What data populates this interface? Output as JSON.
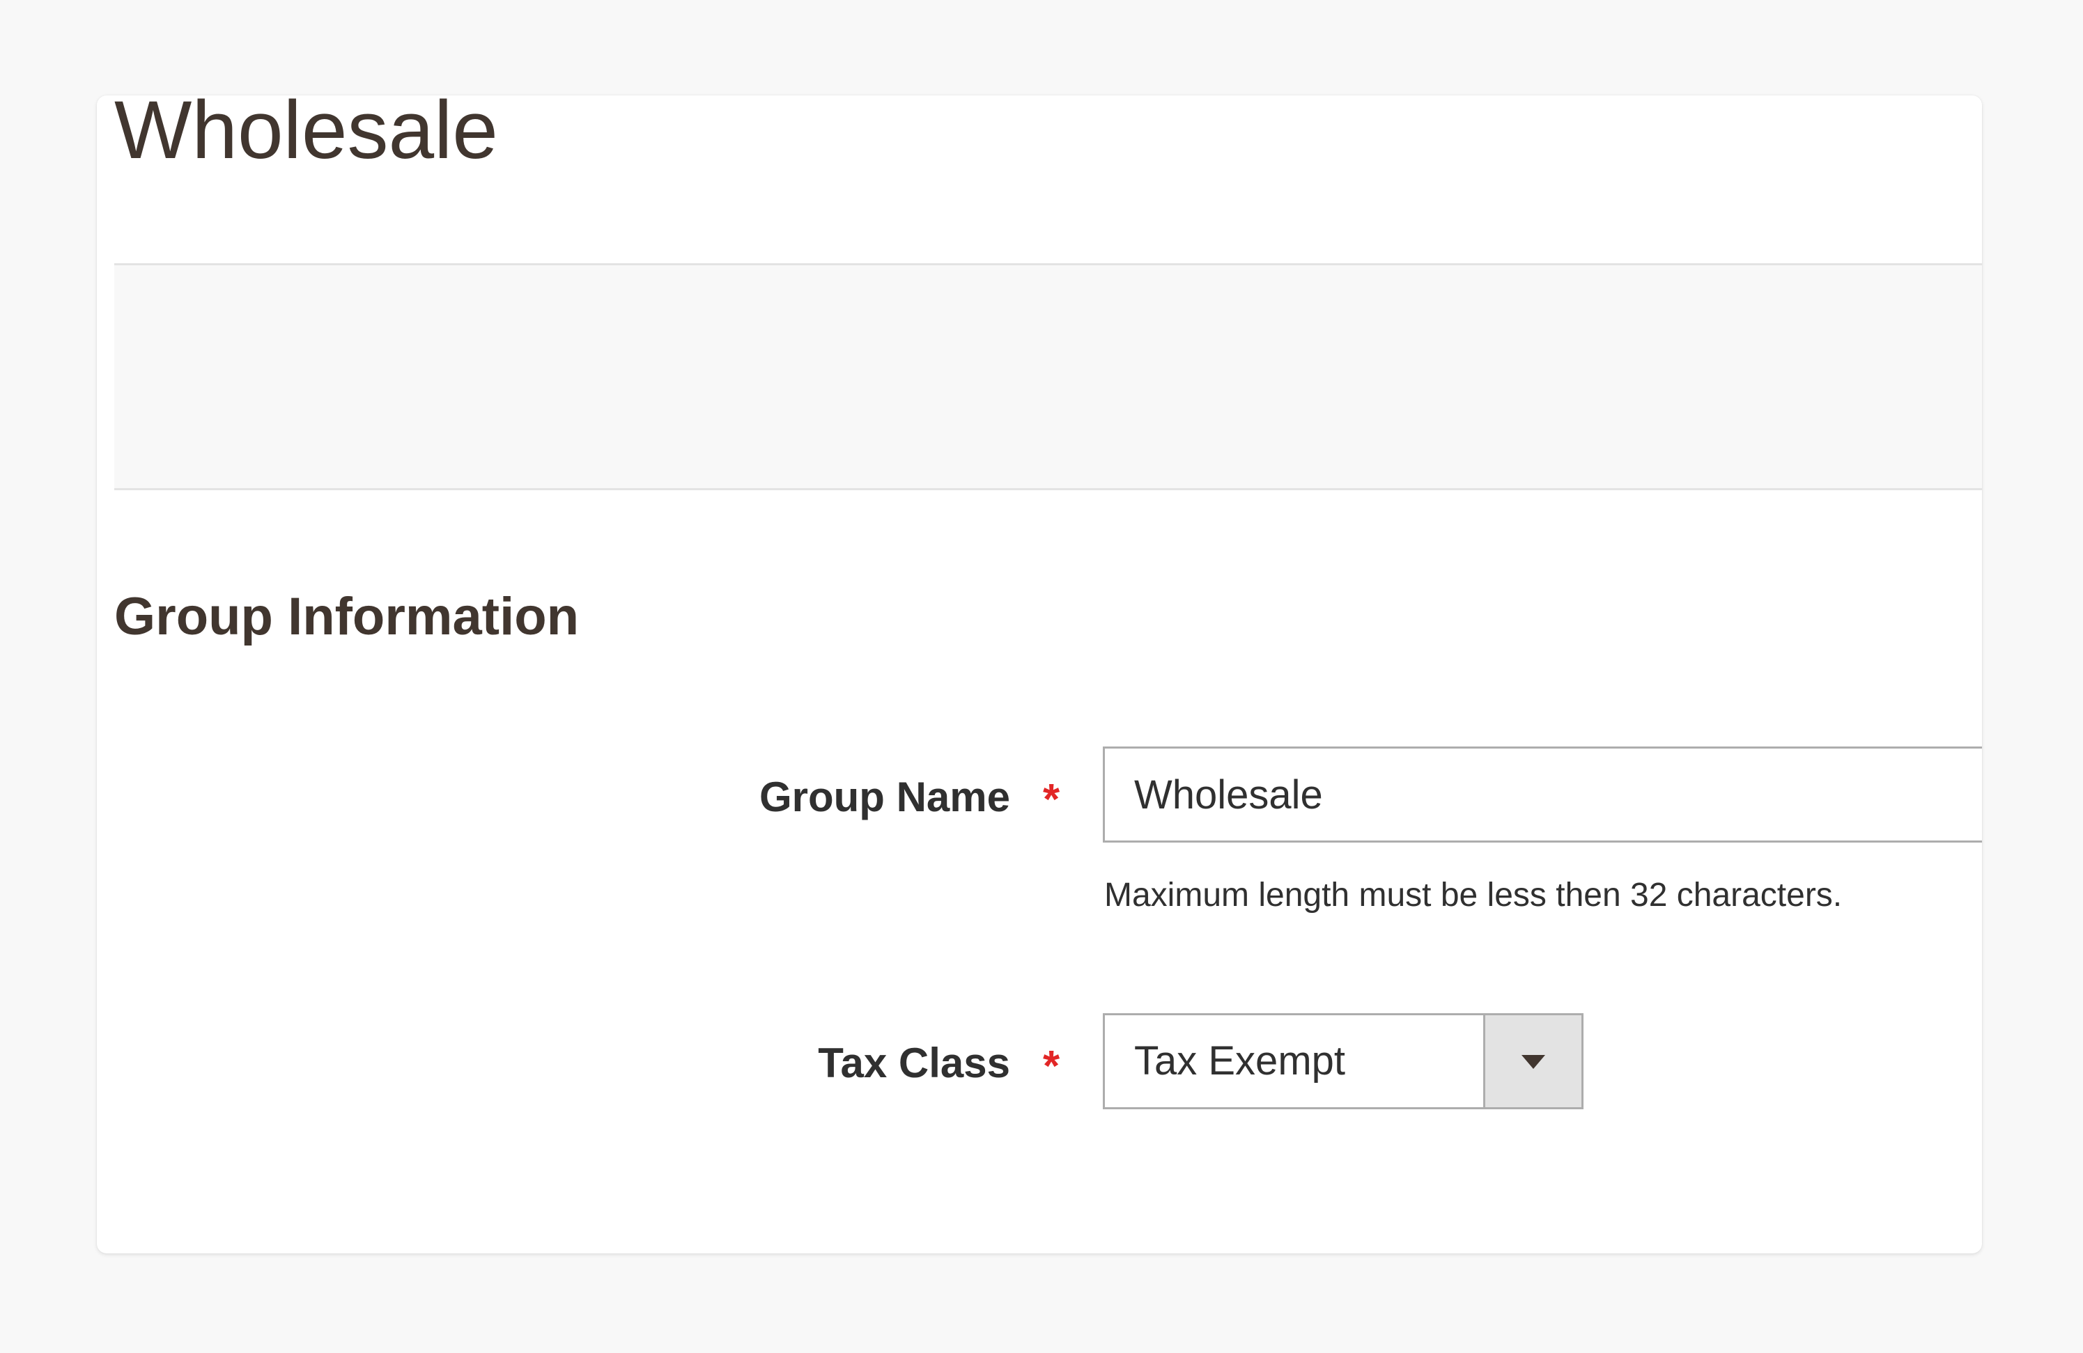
{
  "page": {
    "title": "Wholesale"
  },
  "section": {
    "title": "Group Information"
  },
  "fields": {
    "group_name": {
      "label": "Group Name",
      "required_mark": "*",
      "value": "Wholesale",
      "note": "Maximum length must be less then 32 characters."
    },
    "tax_class": {
      "label": "Tax Class",
      "required_mark": "*",
      "selected": "Tax Exempt"
    }
  },
  "colors": {
    "title_text": "#41362f",
    "required_star": "#e22626",
    "input_border": "#adadad",
    "actions_bar_bg": "#f8f8f8",
    "dropdown_button_bg": "#e3e3e3"
  },
  "icons": {
    "dropdown": "chevron-down-icon"
  }
}
